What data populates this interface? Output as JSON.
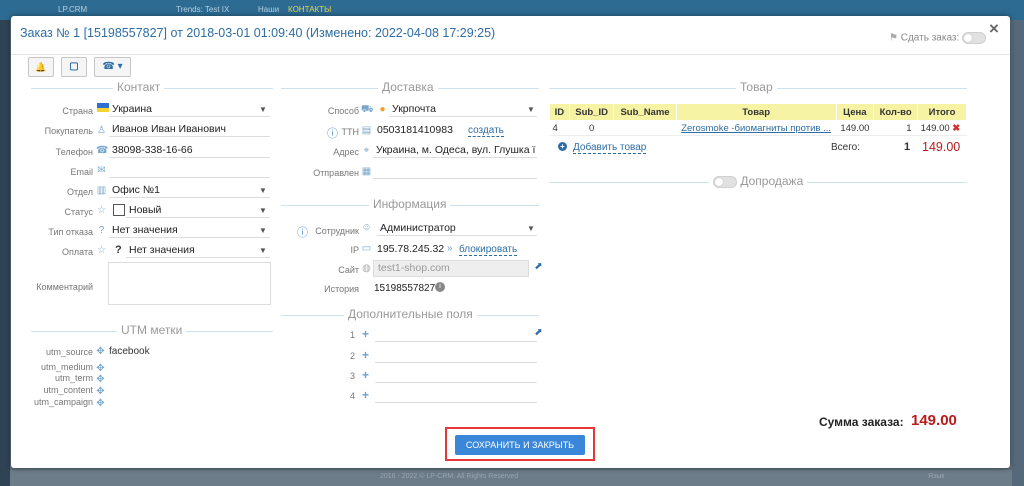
{
  "background": {
    "top_items": [
      "LP.CRM",
      "Trends: Test IX",
      "Наши",
      "КОНТАКТЫ"
    ],
    "bottom_text": "2016 - 2022 © LP-CRM. All Rights Reserved",
    "bottom_right": "Язык"
  },
  "modal": {
    "title": "Заказ № 1 [15198557827] от 2018-03-01 01:09:40 (Изменено: 2022-04-08 17:29:25)",
    "close": "×",
    "rent_label": "Сдать заказ:",
    "toolbar": {
      "bell": "🔔",
      "square": "▢",
      "phone": "☎ ▾"
    }
  },
  "contact": {
    "title": "Контакт",
    "country_label": "Страна",
    "country": "Украина",
    "buyer_label": "Покупатель",
    "buyer": "Иванов Иван Иванович",
    "phone_label": "Телефон",
    "phone": "38098-338-16-66",
    "email_label": "Email",
    "email": "",
    "dept_label": "Отдел",
    "dept": "Офис №1",
    "status_label": "Статус",
    "status": "Новый",
    "refuse_label": "Тип отказа",
    "refuse": "Нет значения",
    "pay_label": "Оплата",
    "pay": "Нет значения",
    "pay_mark": "?",
    "comment_label": "Комментарий"
  },
  "utm": {
    "title": "UTM метки",
    "rows": [
      {
        "label": "utm_source",
        "value": "facebook"
      },
      {
        "label": "utm_medium",
        "value": ""
      },
      {
        "label": "utm_term",
        "value": ""
      },
      {
        "label": "utm_content",
        "value": ""
      },
      {
        "label": "utm_campaign",
        "value": ""
      }
    ]
  },
  "delivery": {
    "title": "Доставка",
    "method_label": "Способ",
    "method": "Укрпочта",
    "ttn_label": "ТТН",
    "ttn": "0503181410983",
    "create": "создать",
    "address_label": "Адрес",
    "address": "Украина, м. Одеса, вул. Глушка ї",
    "sent_label": "Отправлен"
  },
  "info": {
    "title": "Информация",
    "employee_label": "Сотрудник",
    "employee": "Администратор",
    "ip_label": "IP",
    "ip": "195.78.245.32",
    "block": "блокировать",
    "site_label": "Сайт",
    "site": "test1-shop.com",
    "history_label": "История",
    "history": "15198557827"
  },
  "extra": {
    "title": "Дополнительные поля",
    "rows": [
      "1",
      "2",
      "3",
      "4"
    ]
  },
  "goods": {
    "title": "Товар",
    "headers": [
      "ID",
      "Sub_ID",
      "Sub_Name",
      "Товар",
      "Цена",
      "Кол-во",
      "Итого"
    ],
    "row": {
      "id": "4",
      "sub_id": "0",
      "sub_name": "",
      "product": "Zerosmoke -биомагниты против ...",
      "price": "149.00",
      "qty": "1",
      "total": "149.00"
    },
    "add": "Добавить товар",
    "total_label": "Всего:",
    "total_qty": "1",
    "total_sum": "149.00"
  },
  "upsell": {
    "title": "Допродажа"
  },
  "order_sum": {
    "label": "Сумма заказа:",
    "value": "149.00"
  },
  "save_button": "СОХРАНИТЬ И ЗАКРЫТЬ"
}
